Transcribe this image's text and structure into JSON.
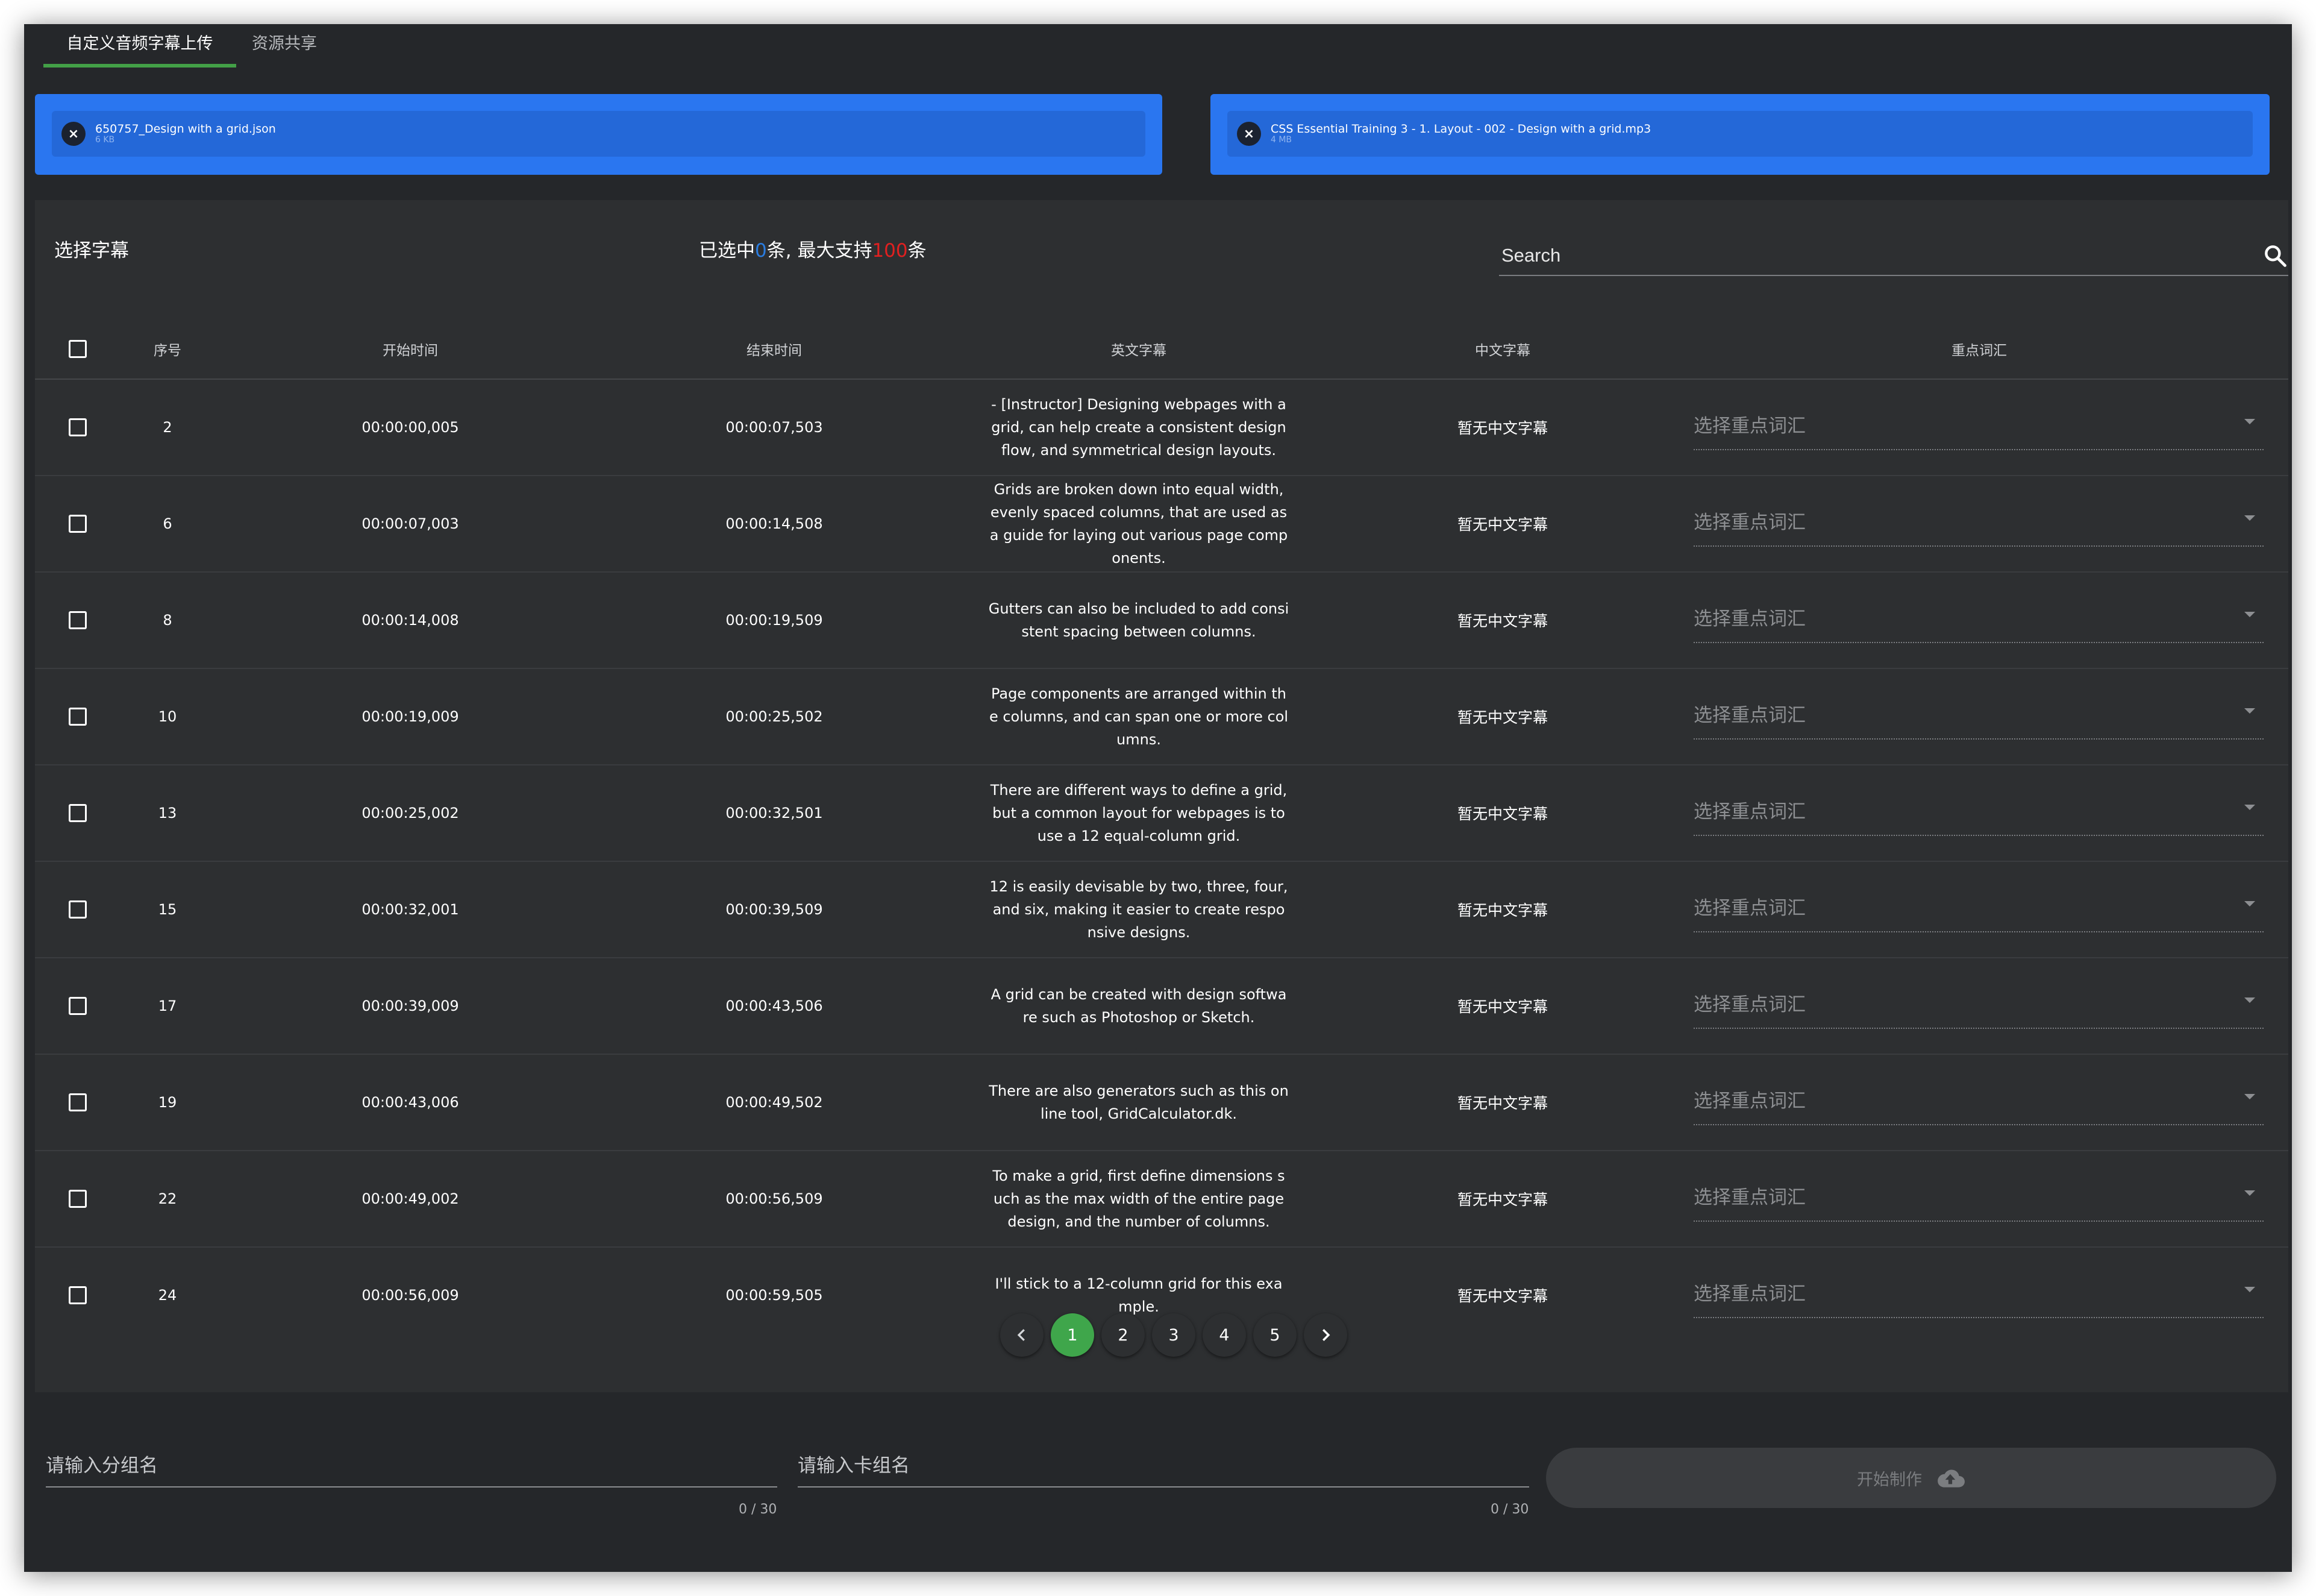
{
  "tabs": [
    {
      "label": "自定义音频字幕上传",
      "active": true
    },
    {
      "label": "资源共享",
      "active": false
    }
  ],
  "uploads": [
    {
      "name": "650757_Design with a grid.json",
      "size": "6 KB"
    },
    {
      "name": "CSS Essential Training 3 - 1. Layout - 002 - Design with a grid.mp3",
      "size": "4 MB"
    }
  ],
  "panel": {
    "title": "选择字幕",
    "selected_prefix": "已选中",
    "selected_count": "0",
    "selected_mid": "条, 最大支持",
    "selected_max": "100",
    "selected_suffix": "条",
    "search_placeholder": "Search"
  },
  "table": {
    "headers": {
      "index": "序号",
      "start": "开始时间",
      "end": "结束时间",
      "english": "英文字幕",
      "chinese": "中文字幕",
      "keywords": "重点词汇"
    },
    "rows": [
      {
        "index": "2",
        "start": "00:00:00,005",
        "end": "00:00:07,503",
        "english": "- [Instructor] Designing webpages with a grid, can help create a consistent design flow, and symmetrical design layouts.",
        "chinese": "暂无中文字幕",
        "keywords": "选择重点词汇"
      },
      {
        "index": "6",
        "start": "00:00:07,003",
        "end": "00:00:14,508",
        "english": "Grids are broken down into equal width, evenly spaced columns, that are used as a guide for laying out various page components.",
        "chinese": "暂无中文字幕",
        "keywords": "选择重点词汇"
      },
      {
        "index": "8",
        "start": "00:00:14,008",
        "end": "00:00:19,509",
        "english": "Gutters can also be included to add consistent spacing between columns.",
        "chinese": "暂无中文字幕",
        "keywords": "选择重点词汇"
      },
      {
        "index": "10",
        "start": "00:00:19,009",
        "end": "00:00:25,502",
        "english": "Page components are arranged within the columns, and can span one or more columns.",
        "chinese": "暂无中文字幕",
        "keywords": "选择重点词汇"
      },
      {
        "index": "13",
        "start": "00:00:25,002",
        "end": "00:00:32,501",
        "english": "There are different ways to define a grid, but a common layout for webpages is to use a 12 equal-column grid.",
        "chinese": "暂无中文字幕",
        "keywords": "选择重点词汇"
      },
      {
        "index": "15",
        "start": "00:00:32,001",
        "end": "00:00:39,509",
        "english": "12 is easily devisable by two, three, four, and six, making it easier to create responsive designs.",
        "chinese": "暂无中文字幕",
        "keywords": "选择重点词汇"
      },
      {
        "index": "17",
        "start": "00:00:39,009",
        "end": "00:00:43,506",
        "english": "A grid can be created with design software such as Photoshop or Sketch.",
        "chinese": "暂无中文字幕",
        "keywords": "选择重点词汇"
      },
      {
        "index": "19",
        "start": "00:00:43,006",
        "end": "00:00:49,502",
        "english": "There are also generators such as this online tool, GridCalculator.dk.",
        "chinese": "暂无中文字幕",
        "keywords": "选择重点词汇"
      },
      {
        "index": "22",
        "start": "00:00:49,002",
        "end": "00:00:56,509",
        "english": "To make a grid, first define dimensions such as the max width of the entire page design, and the number of columns.",
        "chinese": "暂无中文字幕",
        "keywords": "选择重点词汇"
      },
      {
        "index": "24",
        "start": "00:00:56,009",
        "end": "00:00:59,505",
        "english": "I'll stick to a 12-column grid for this example.",
        "chinese": "暂无中文字幕",
        "keywords": "选择重点词汇"
      }
    ]
  },
  "pagination": {
    "pages": [
      "1",
      "2",
      "3",
      "4",
      "5"
    ],
    "current": "1",
    "prev_icon": "chevron-left-icon",
    "next_icon": "chevron-right-icon"
  },
  "form": {
    "group_placeholder": "请输入分组名",
    "group_counter": "0 / 30",
    "card_placeholder": "请输入卡组名",
    "card_counter": "0 / 30",
    "start_label": "开始制作",
    "start_icon": "cloud-upload-icon"
  },
  "colors": {
    "accent_green": "#43a047",
    "upload_blue": "#2a76f0",
    "count_blue": "#2a7de1",
    "max_red": "#e02020",
    "background": "#25272a"
  }
}
